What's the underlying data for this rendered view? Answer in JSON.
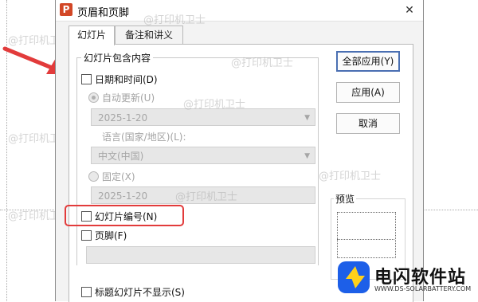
{
  "dialog": {
    "title": "页眉和页脚",
    "app_icon_letter": "P",
    "close_glyph": "✕"
  },
  "tabs": [
    {
      "label": "幻灯片"
    },
    {
      "label": "备注和讲义"
    }
  ],
  "group": {
    "title": "幻灯片包含内容",
    "datetime_label": "日期和时间(D)",
    "auto_update_label": "自动更新(U)",
    "auto_update_value": "2025-1-20",
    "language_label": "语言(国家/地区)(L):",
    "language_value": "中文(中国)",
    "fixed_label": "固定(X)",
    "fixed_value": "2025-1-20",
    "slide_number_label": "幻灯片编号(N)",
    "footer_label": "页脚(F)",
    "footer_value": ""
  },
  "hide_on_title_label": "标题幻灯片不显示(S)",
  "buttons": {
    "apply_all": "全部应用(Y)",
    "apply": "应用(A)",
    "cancel": "取消"
  },
  "preview_label": "预览",
  "watermark": "@打印机卫士",
  "brand": {
    "name": "电闪软件站",
    "url": "WWW.DS-SOLARBATTERY.COM"
  },
  "colors": {
    "annotation_red": "#e23b3b",
    "brand_blue": "#1d5fe8",
    "brand_yellow": "#ffd11a"
  }
}
